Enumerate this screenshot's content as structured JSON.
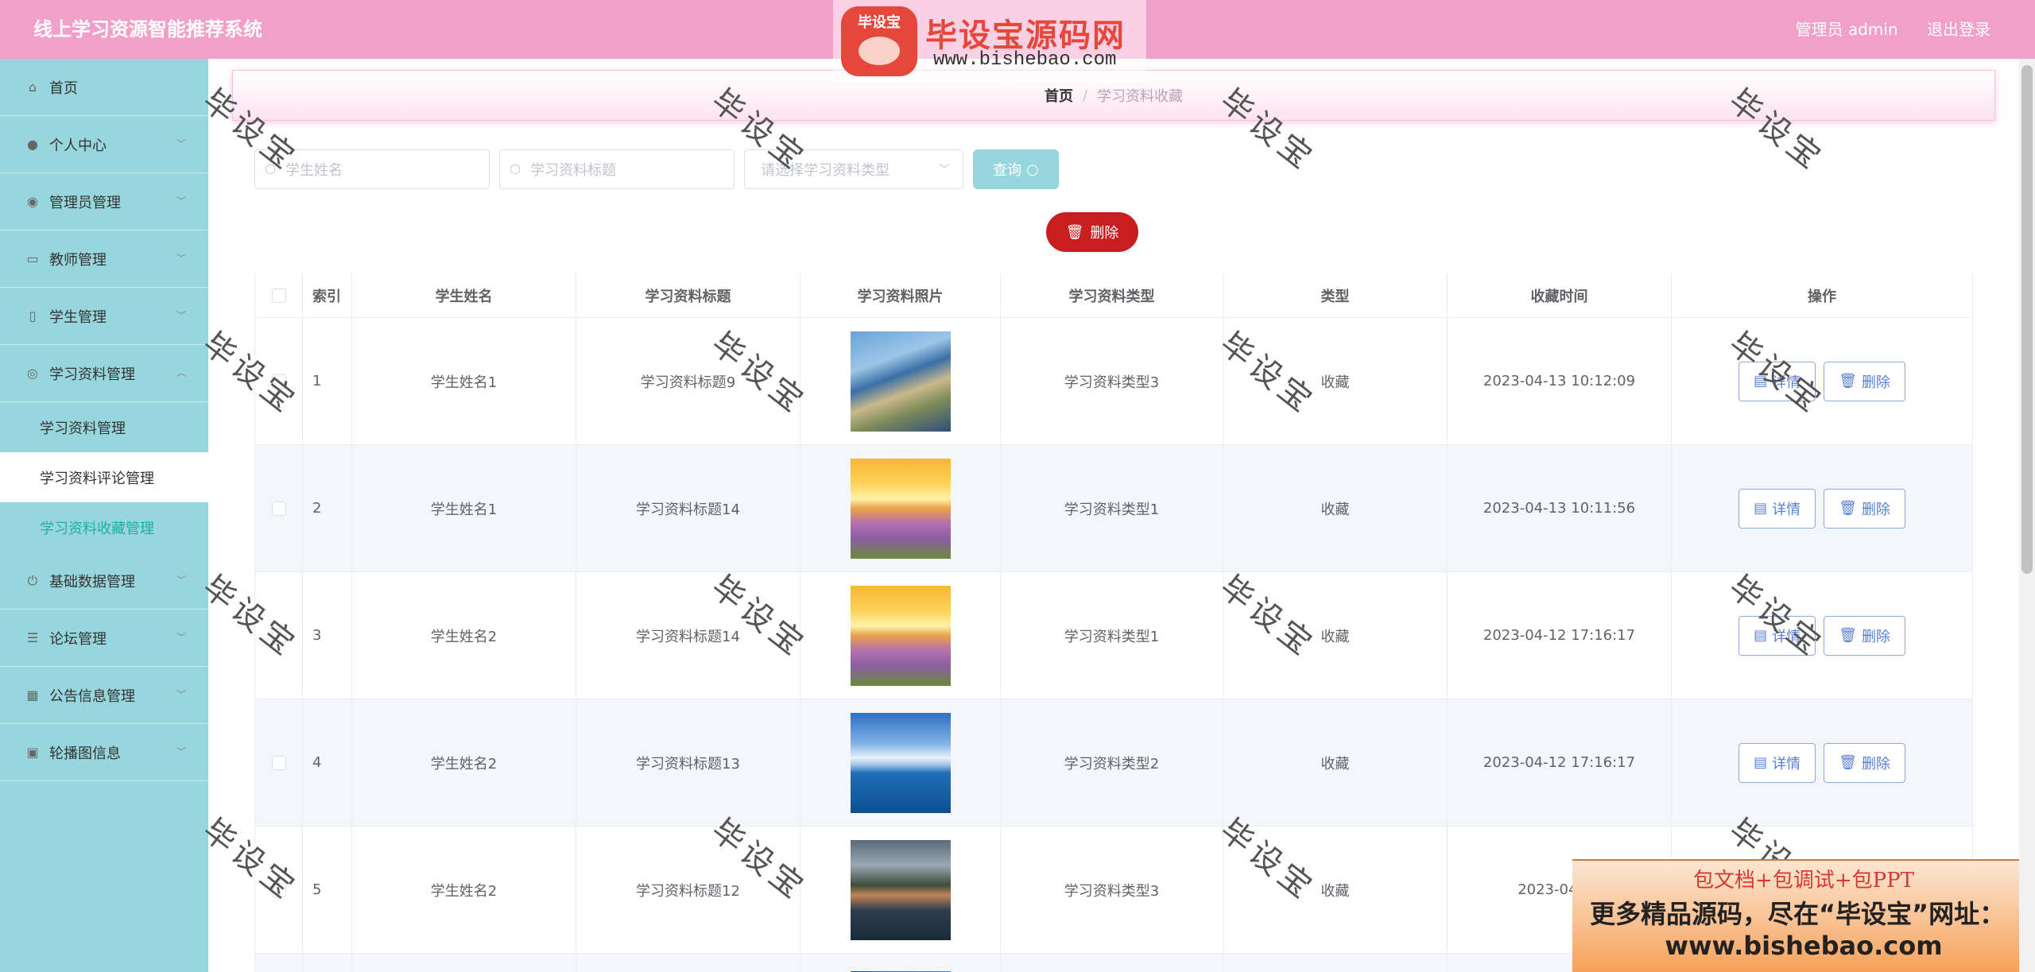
{
  "header": {
    "app_title": "线上学习资源智能推荐系统",
    "admin_label": "管理员 admin",
    "logout_label": "退出登录"
  },
  "logo_watermark": {
    "badge": "毕设宝",
    "title": "毕设宝源码网",
    "url": "www.bishebao.com"
  },
  "sidebar": {
    "items": [
      {
        "label": "首页",
        "icon": "home-icon"
      },
      {
        "label": "个人中心",
        "icon": "user-icon"
      },
      {
        "label": "管理员管理",
        "icon": "location-icon"
      },
      {
        "label": "教师管理",
        "icon": "chat-icon"
      },
      {
        "label": "学生管理",
        "icon": "microphone-icon"
      },
      {
        "label": "学习资料管理",
        "icon": "globe-icon"
      }
    ],
    "sub_items": [
      {
        "label": "学习资料管理"
      },
      {
        "label": "学习资料评论管理"
      },
      {
        "label": "学习资料收藏管理"
      }
    ],
    "items_after": [
      {
        "label": "基础数据管理",
        "icon": "power-icon"
      },
      {
        "label": "论坛管理",
        "icon": "list-icon"
      },
      {
        "label": "公告信息管理",
        "icon": "grid-icon"
      },
      {
        "label": "轮播图信息",
        "icon": "clipboard-icon"
      }
    ]
  },
  "breadcrumb": {
    "home": "首页",
    "separator": "/",
    "current": "学习资料收藏"
  },
  "search": {
    "student_name_placeholder": "学生姓名",
    "title_placeholder": "学习资料标题",
    "type_placeholder": "请选择学习资料类型",
    "query_label": "查询"
  },
  "delete_button": "删除",
  "table": {
    "headers": [
      "索引",
      "学生姓名",
      "学习资料标题",
      "学习资料照片",
      "学习资料类型",
      "类型",
      "收藏时间",
      "操作"
    ],
    "rows": [
      {
        "index": "1",
        "student": "学生姓名1",
        "title": "学习资料标题9",
        "photo": "river-delta",
        "material_type": "学习资料类型3",
        "kind": "收藏",
        "time": "2023-04-13 10:12:09"
      },
      {
        "index": "2",
        "student": "学生姓名1",
        "title": "学习资料标题14",
        "photo": "sunset-flowers",
        "material_type": "学习资料类型1",
        "kind": "收藏",
        "time": "2023-04-13 10:11:56"
      },
      {
        "index": "3",
        "student": "学生姓名2",
        "title": "学习资料标题14",
        "photo": "sunset-flowers",
        "material_type": "学习资料类型1",
        "kind": "收藏",
        "time": "2023-04-12 17:16:17"
      },
      {
        "index": "4",
        "student": "学生姓名2",
        "title": "学习资料标题13",
        "photo": "sea-sky",
        "material_type": "学习资料类型2",
        "kind": "收藏",
        "time": "2023-04-12 17:16:17"
      },
      {
        "index": "5",
        "student": "学生姓名2",
        "title": "学习资料标题12",
        "photo": "mountain-village",
        "material_type": "学习资料类型3",
        "kind": "收藏",
        "time": "2023-04-12"
      }
    ],
    "detail_label": "详情",
    "delete_label": "删除"
  },
  "watermark_text": "毕设宝",
  "promo": {
    "line1": "包文档+包调试+包PPT",
    "line2": "更多精品源码，尽在“毕设宝”网址：",
    "line3": "www.bishebao.com"
  },
  "colors": {
    "header_bg": "#f2a0c9",
    "sidebar_bg": "#98d6dd",
    "delete_red": "#c81e22",
    "active_green": "#1bb19c",
    "op_blue": "#5a7fd6"
  }
}
